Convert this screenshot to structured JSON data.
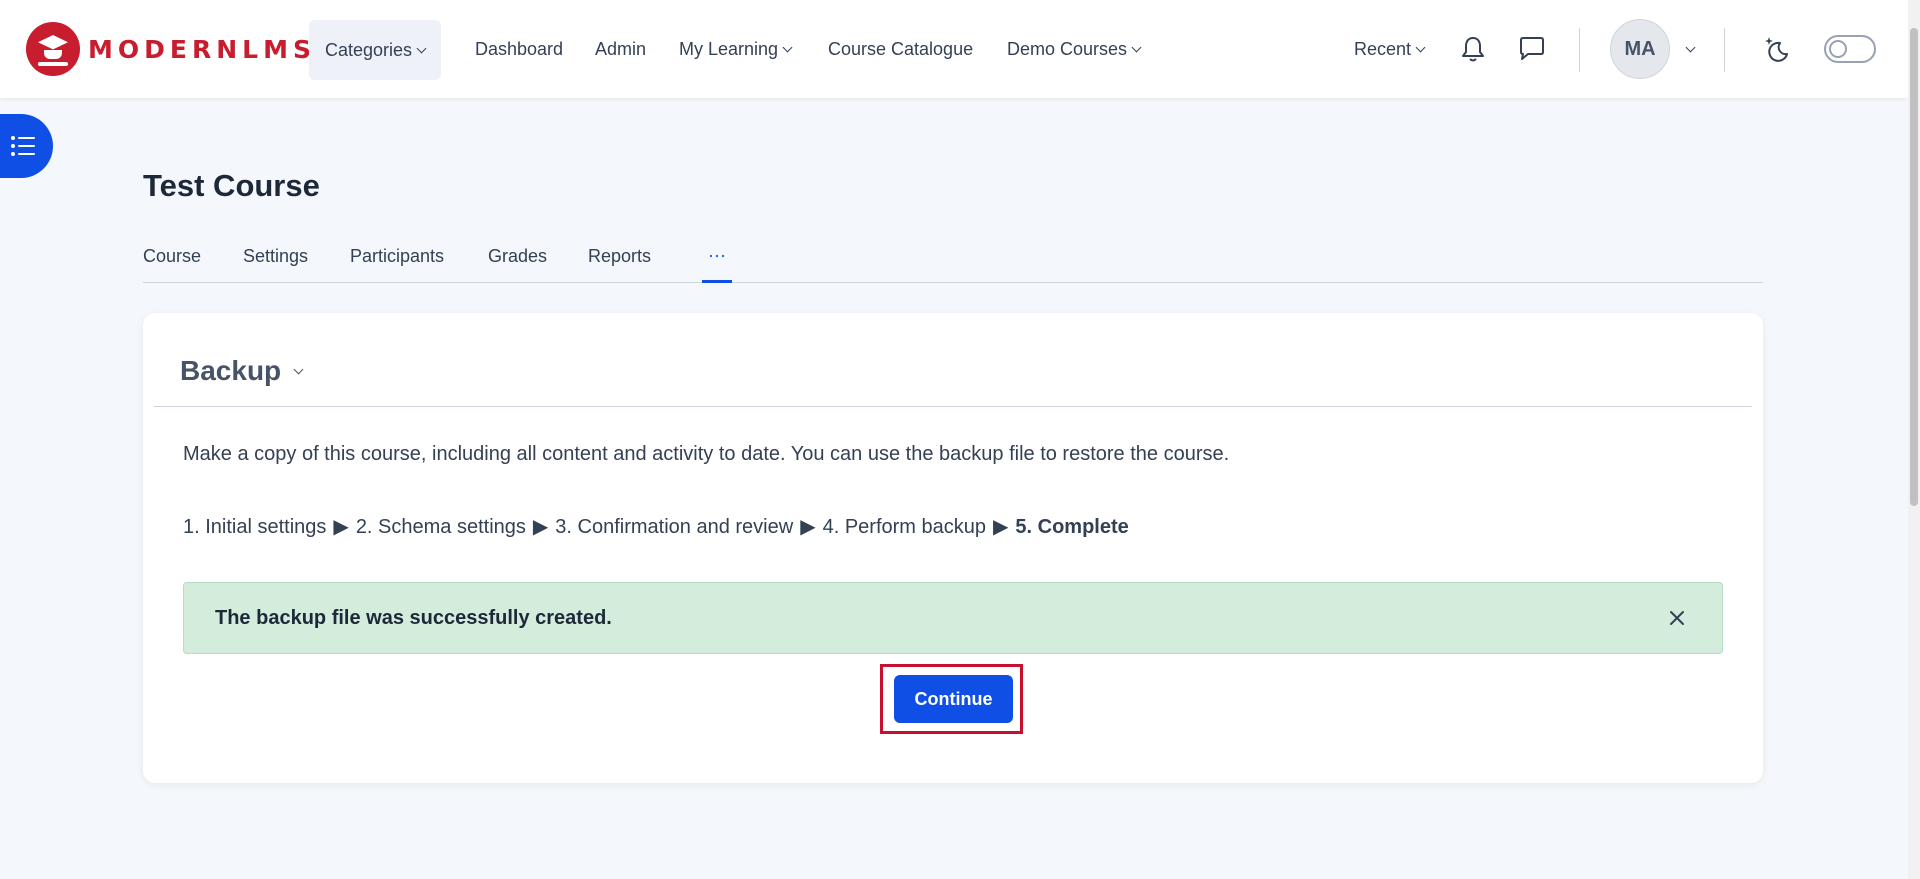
{
  "navbar": {
    "logo_text": "MODERNLMS",
    "items": [
      {
        "label": "Categories",
        "dropdown": true
      },
      {
        "label": "Dashboard",
        "dropdown": false
      },
      {
        "label": "Admin",
        "dropdown": false
      },
      {
        "label": "My Learning",
        "dropdown": true
      },
      {
        "label": "Course Catalogue",
        "dropdown": false
      },
      {
        "label": "Demo Courses",
        "dropdown": true
      }
    ],
    "recent_label": "Recent",
    "avatar_initials": "MA",
    "icons": [
      "bell-icon",
      "chat-icon",
      "moon-sparkle-icon",
      "list-icon",
      "close-icon"
    ]
  },
  "page": {
    "title": "Test Course"
  },
  "secondary_nav": {
    "items": [
      "Course",
      "Settings",
      "Participants",
      "Grades",
      "Reports"
    ],
    "more_label": "···"
  },
  "backup": {
    "title": "Backup",
    "intro": "Make a copy of this course, including all content and activity to date. You can use the backup file to restore the course.",
    "steps": [
      "1. Initial settings",
      "2. Schema settings",
      "3. Confirmation and review",
      "4. Perform backup",
      "5. Complete"
    ],
    "step_separator": "▶",
    "alert": "The backup file was successfully created.",
    "continue_label": "Continue"
  },
  "colors": {
    "brand": "#c81d2f",
    "primary": "#0f4fe6",
    "success_bg": "#d4ecdc",
    "highlight": "#c8102e"
  }
}
